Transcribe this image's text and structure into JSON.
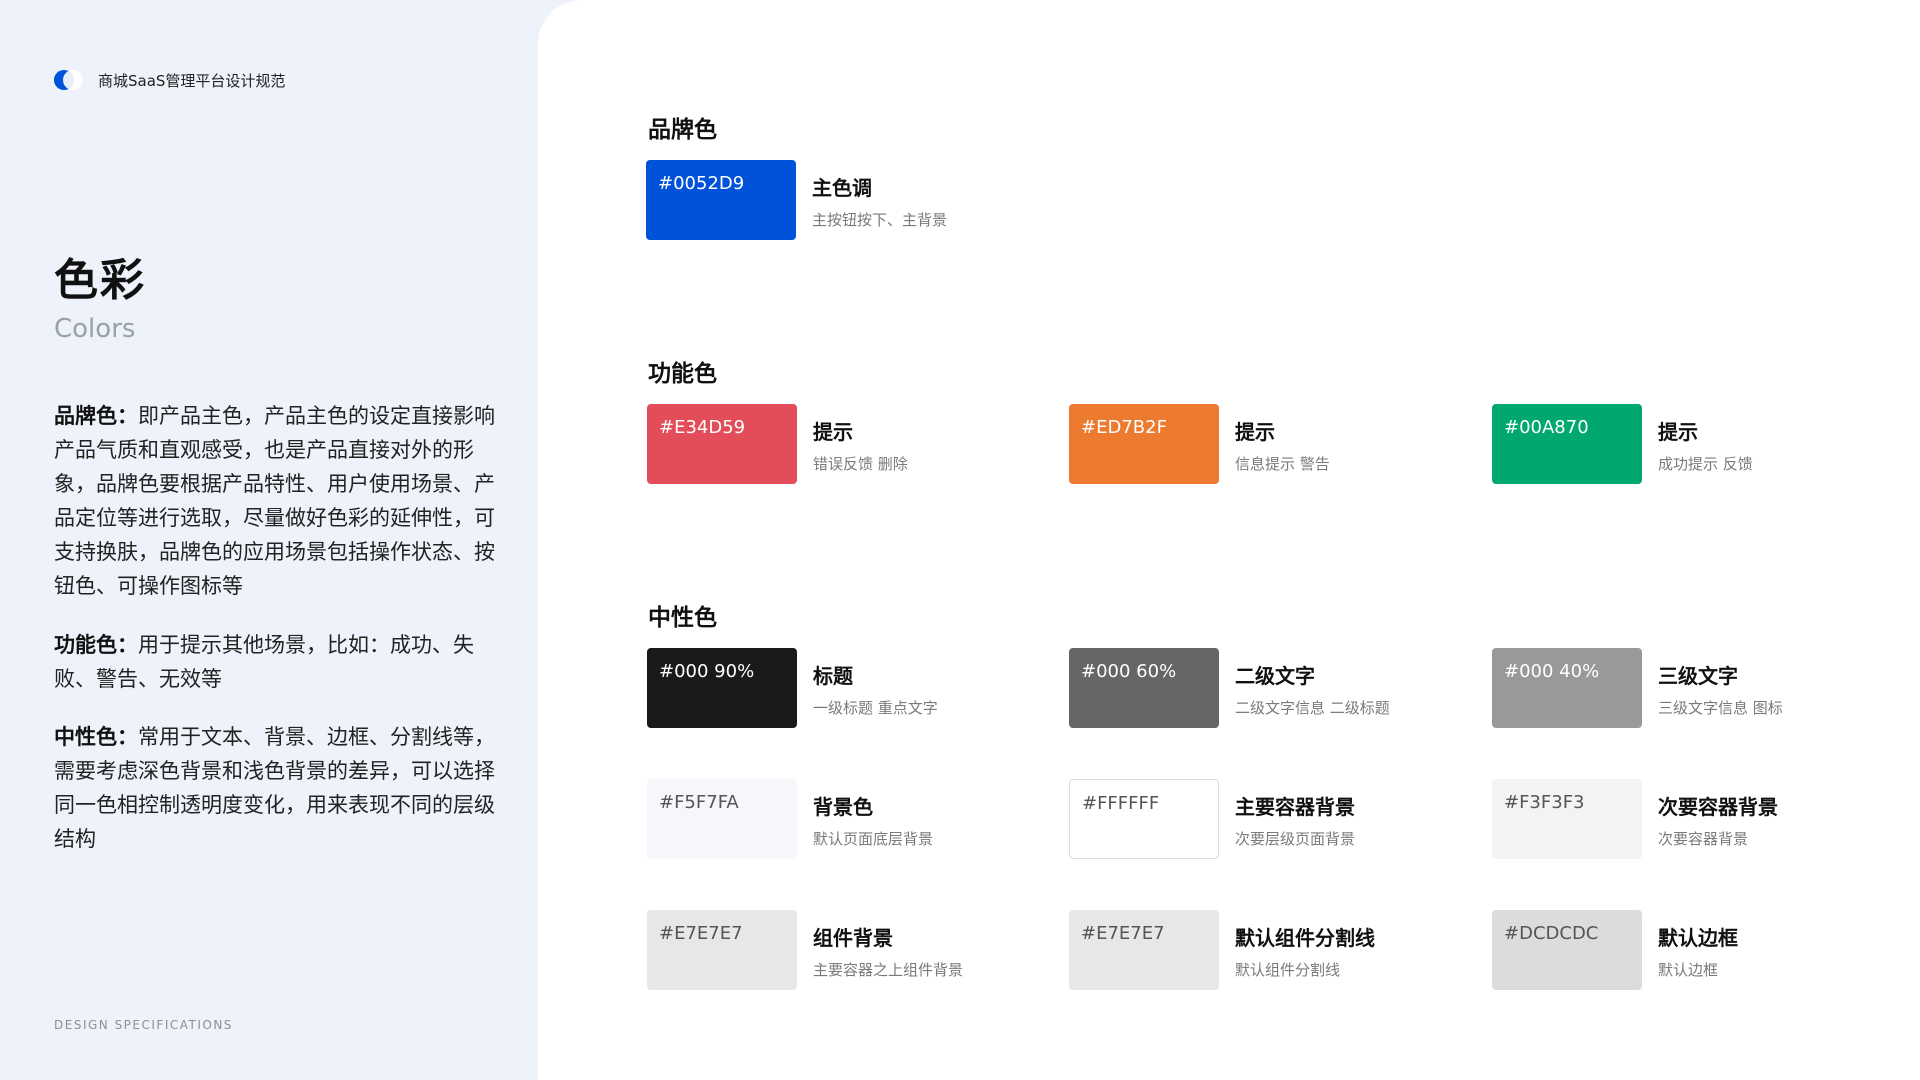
{
  "sidebar": {
    "brand": "商城SaaS管理平台设计规范",
    "title": "色彩",
    "subtitle": "Colors",
    "desc": [
      {
        "label": "品牌色：",
        "text": "即产品主色，产品主色的设定直接影响产品气质和直观感受，也是产品直接对外的形象，品牌色要根据产品特性、用户使用场景、产品定位等进行选取，尽量做好色彩的延伸性，可支持换肤，品牌色的应用场景包括操作状态、按钮色、可操作图标等"
      },
      {
        "label": "功能色：",
        "text": "用于提示其他场景，比如：成功、失败、警告、无效等"
      },
      {
        "label": "中性色：",
        "text": "常用于文本、背景、边框、分割线等，需要考虑深色背景和浅色背景的差异，可以选择同一色相控制透明度变化，用来表现不同的层级结构"
      }
    ],
    "footer": "DESIGN SPECIFICATIONS"
  },
  "sections": {
    "brand": {
      "title": "品牌色",
      "items": [
        {
          "code": "#0052D9",
          "color": "#0052D9",
          "name": "主色调",
          "note": "主按钮按下、主背景"
        }
      ]
    },
    "functional": {
      "title": "功能色",
      "items": [
        {
          "code": "#E34D59",
          "color": "#E34D59",
          "name": "提示",
          "note": "错误反馈 删除"
        },
        {
          "code": "#ED7B2F",
          "color": "#ED7B2F",
          "name": "提示",
          "note": "信息提示 警告"
        },
        {
          "code": "#00A870",
          "color": "#00A870",
          "name": "提示",
          "note": "成功提示 反馈"
        }
      ]
    },
    "neutral": {
      "title": "中性色",
      "items": [
        {
          "code": "#000 90%",
          "color": "#1a1a1a",
          "name": "标题",
          "note": "一级标题 重点文字"
        },
        {
          "code": "#000 60%",
          "color": "#666666",
          "name": "二级文字",
          "note": "二级文字信息 二级标题"
        },
        {
          "code": "#000 40%",
          "color": "#999999",
          "name": "三级文字",
          "note": "三级文字信息 图标"
        },
        {
          "code": "#F5F7FA",
          "color": "#F5F7FA",
          "name": "背景色",
          "note": "默认页面底层背景"
        },
        {
          "code": "#FFFFFF",
          "color": "#FFFFFF",
          "name": "主要容器背景",
          "note": "次要层级页面背景"
        },
        {
          "code": "#F3F3F3",
          "color": "#F3F3F3",
          "name": "次要容器背景",
          "note": "次要容器背景"
        },
        {
          "code": "#E7E7E7",
          "color": "#E7E7E7",
          "name": "组件背景",
          "note": "主要容器之上组件背景"
        },
        {
          "code": "#E7E7E7",
          "color": "#E7E7E7",
          "name": "默认组件分割线",
          "note": "默认组件分割线"
        },
        {
          "code": "#DCDCDC",
          "color": "#DCDCDC",
          "name": "默认边框",
          "note": "默认边框"
        }
      ]
    }
  }
}
